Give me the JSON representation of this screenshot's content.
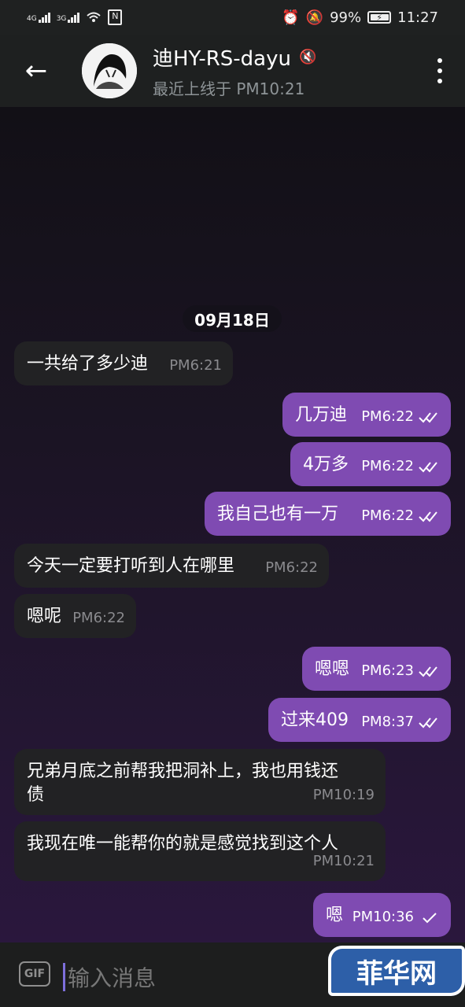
{
  "status_bar": {
    "network_1": "4G",
    "network_2": "3G",
    "battery": "99%",
    "time": "11:27",
    "icons": [
      "signal-icon",
      "wifi-icon",
      "nfc-icon",
      "alarm-icon",
      "mute-icon",
      "battery-icon"
    ]
  },
  "header": {
    "title": "迪HY-RS-dayu",
    "subtitle": "最近上线于 PM10:21",
    "back_icon": "arrow-left",
    "mute_icon": "mute-icon",
    "menu_icon": "more-vertical"
  },
  "chat": {
    "date": "09月18日",
    "messages": [
      {
        "direction": "in",
        "text": "一共给了多少迪",
        "time": "PM6:21",
        "read": false
      },
      {
        "direction": "out",
        "text": "几万迪",
        "time": "PM6:22",
        "read": true
      },
      {
        "direction": "out",
        "text": "4万多",
        "time": "PM6:22",
        "read": true
      },
      {
        "direction": "out",
        "text": "我自己也有一万",
        "time": "PM6:22",
        "read": true
      },
      {
        "direction": "in",
        "text": "今天一定要打听到人在哪里",
        "time": "PM6:22",
        "read": false
      },
      {
        "direction": "in",
        "text": "嗯呢",
        "time": "PM6:22",
        "read": false
      },
      {
        "direction": "out",
        "text": "嗯嗯",
        "time": "PM6:23",
        "read": true
      },
      {
        "direction": "out",
        "text": "过来409",
        "time": "PM8:37",
        "read": true
      },
      {
        "direction": "in",
        "text": "兄弟月底之前帮我把洞补上，我也用钱还\n债",
        "time": "PM10:19",
        "read": false
      },
      {
        "direction": "in",
        "text": "我现在唯一能帮你的就是感觉找到这个人",
        "time": "PM10:21",
        "read": false
      },
      {
        "direction": "out",
        "text": "嗯",
        "time": "PM10:36",
        "read": false
      }
    ]
  },
  "composer": {
    "gif_label": "GIF",
    "placeholder": "输入消息",
    "watermark": "菲华网"
  },
  "colors": {
    "incoming_bubble": "#222224",
    "outgoing_bubble": "#7f4bb2",
    "header_bg": "#1e2020",
    "accent": "#7d6fdb"
  }
}
